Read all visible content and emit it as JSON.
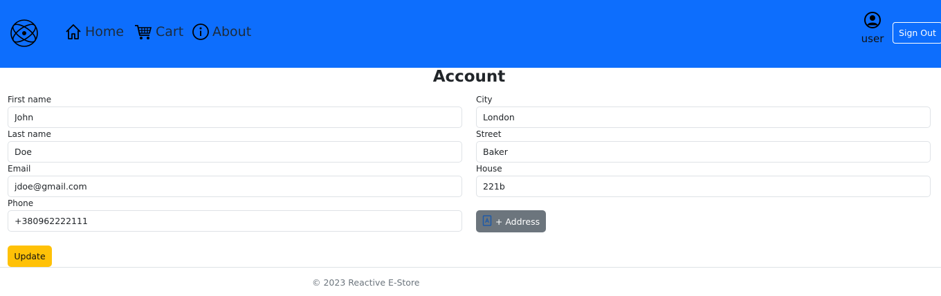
{
  "nav": {
    "logo_icon": "atom-logo-icon",
    "links": [
      {
        "label": "Home",
        "icon": "home-icon"
      },
      {
        "label": "Cart",
        "icon": "cart-icon"
      },
      {
        "label": "About",
        "icon": "info-icon"
      }
    ],
    "user": {
      "name": "user",
      "icon": "user-circle-icon"
    },
    "signout_label": "Sign Out"
  },
  "page": {
    "title": "Account"
  },
  "form": {
    "first_name": {
      "label": "First name",
      "value": "John"
    },
    "last_name": {
      "label": "Last name",
      "value": "Doe"
    },
    "email": {
      "label": "Email",
      "value": "jdoe@gmail.com"
    },
    "phone": {
      "label": "Phone",
      "value": "+380962222111"
    },
    "city": {
      "label": "City",
      "value": "London"
    },
    "street": {
      "label": "Street",
      "value": "Baker"
    },
    "house": {
      "label": "House",
      "value": "221b"
    },
    "add_address_label": "+ Address",
    "update_label": "Update"
  },
  "footer": {
    "text": "© 2023 Reactive E-Store"
  },
  "colors": {
    "navbar": "#0d6efd",
    "address_button": "#6c757d",
    "update_button": "#ffc107"
  }
}
